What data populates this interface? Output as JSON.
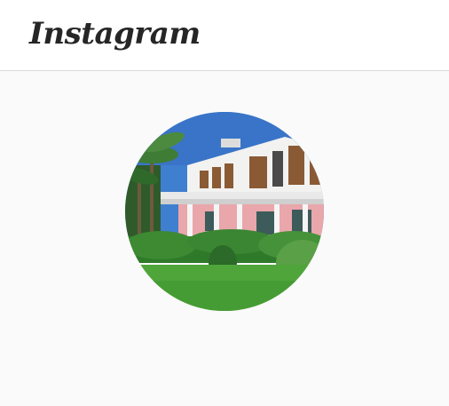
{
  "header": {
    "logo_text": "Instagram"
  },
  "profile": {
    "avatar_alt": "profile-photo"
  },
  "colors": {
    "header_bg": "#ffffff",
    "page_bg": "#fafafa",
    "divider": "#dbdbdb",
    "logo": "#262626"
  }
}
